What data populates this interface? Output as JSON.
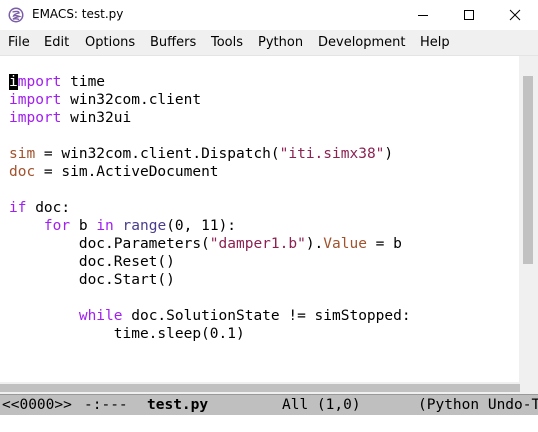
{
  "window": {
    "title": "EMACS: test.py",
    "minimize_icon": "minimize-icon",
    "maximize_icon": "maximize-icon",
    "close_icon": "close-icon"
  },
  "menu": {
    "items": [
      "File",
      "Edit",
      "Options",
      "Buffers",
      "Tools",
      "Python",
      "Development",
      "Help"
    ]
  },
  "code": {
    "lines": [
      [
        {
          "t": "i",
          "c": "cursor-char"
        },
        {
          "t": "mport",
          "c": "kw"
        },
        {
          "t": " time",
          "c": ""
        }
      ],
      [
        {
          "t": "import",
          "c": "kw"
        },
        {
          "t": " win32com.client",
          "c": ""
        }
      ],
      [
        {
          "t": "import",
          "c": "kw"
        },
        {
          "t": " win32ui",
          "c": ""
        }
      ],
      [],
      [
        {
          "t": "sim",
          "c": "var"
        },
        {
          "t": " = win32com.client.Dispatch(",
          "c": ""
        },
        {
          "t": "\"iti.simx38\"",
          "c": "str"
        },
        {
          "t": ")",
          "c": ""
        }
      ],
      [
        {
          "t": "doc",
          "c": "var"
        },
        {
          "t": " = sim.ActiveDocument",
          "c": ""
        }
      ],
      [],
      [
        {
          "t": "if",
          "c": "kw"
        },
        {
          "t": " doc:",
          "c": ""
        }
      ],
      [
        {
          "t": "    ",
          "c": ""
        },
        {
          "t": "for",
          "c": "kw"
        },
        {
          "t": " b ",
          "c": ""
        },
        {
          "t": "in",
          "c": "kw"
        },
        {
          "t": " ",
          "c": ""
        },
        {
          "t": "range",
          "c": "bi"
        },
        {
          "t": "(0, 11):",
          "c": ""
        }
      ],
      [
        {
          "t": "        doc.Parameters(",
          "c": ""
        },
        {
          "t": "\"damper1.b\"",
          "c": "str"
        },
        {
          "t": ").",
          "c": ""
        },
        {
          "t": "Value",
          "c": "var"
        },
        {
          "t": " = b",
          "c": ""
        }
      ],
      [
        {
          "t": "        doc.Reset()",
          "c": ""
        }
      ],
      [
        {
          "t": "        doc.Start()",
          "c": ""
        }
      ],
      [],
      [
        {
          "t": "        ",
          "c": ""
        },
        {
          "t": "while",
          "c": "kw"
        },
        {
          "t": " doc.SolutionState != simStopped:",
          "c": ""
        }
      ],
      [
        {
          "t": "            time.sleep(0.1)",
          "c": ""
        }
      ]
    ]
  },
  "modeline": {
    "buffer_id": "<<0000>>",
    "status": "-:---",
    "filename": "test.py",
    "position": "All (1,0)",
    "mode": "(Python Undo-T"
  },
  "colors": {
    "keyword": "#a020f0",
    "string": "#8b2252",
    "builtin": "#483d8b",
    "variable": "#a0522d",
    "modeline_bg": "#bfbfbf"
  }
}
